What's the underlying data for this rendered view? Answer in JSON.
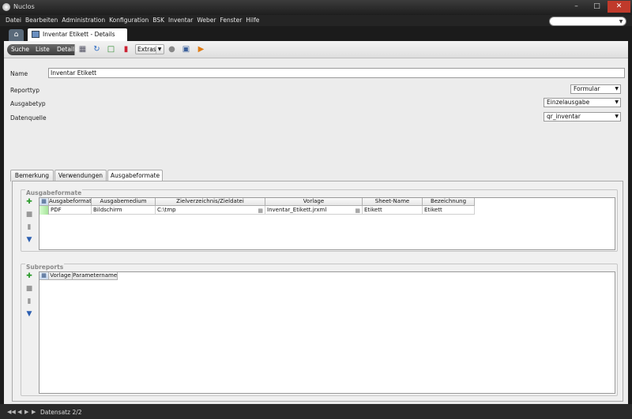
{
  "window": {
    "title": "Nuclos"
  },
  "menu": {
    "items": [
      "Datei",
      "Bearbeiten",
      "Administration",
      "Konfiguration",
      "BSK",
      "Inventar",
      "Weber",
      "Fenster",
      "Hilfe"
    ]
  },
  "doc_tab": {
    "label": "Inventar Etikett - Details"
  },
  "toolbar": {
    "nav": [
      "Suche",
      "Liste",
      "Details"
    ],
    "extras_label": "Extras"
  },
  "form": {
    "name_label": "Name",
    "name_value": "Inventar Etikett",
    "reporttyp_label": "Reporttyp",
    "reporttyp_value": "Formular",
    "ausgabetyp_label": "Ausgabetyp",
    "ausgabetyp_value": "Einzelausgabe",
    "datenquelle_label": "Datenquelle",
    "datenquelle_value": "qr_inventar"
  },
  "tabs": [
    "Bemerkung",
    "Verwendungen",
    "Ausgabeformate"
  ],
  "ausgabeformate": {
    "title": "Ausgabeformate",
    "columns": [
      "Ausgabeformat",
      "Ausgabemedium",
      "Zielverzeichnis/Zieldatei",
      "Vorlage",
      "Sheet-Name",
      "Bezeichnung"
    ],
    "rows": [
      [
        "PDF",
        "Bildschirm",
        "C:\\tmp",
        "Inventar_Etikett.jrxml",
        "Etikett",
        "Etikett"
      ]
    ]
  },
  "subreports": {
    "title": "Subreports",
    "columns": [
      "Vorlage",
      "Parametername"
    ]
  },
  "status": {
    "text": "Datensatz 2/2"
  },
  "colors": {
    "titlebar": "#2a2a2a",
    "panel": "#ececec",
    "close": "#c03a2b",
    "accent": "#3a6ab0"
  }
}
